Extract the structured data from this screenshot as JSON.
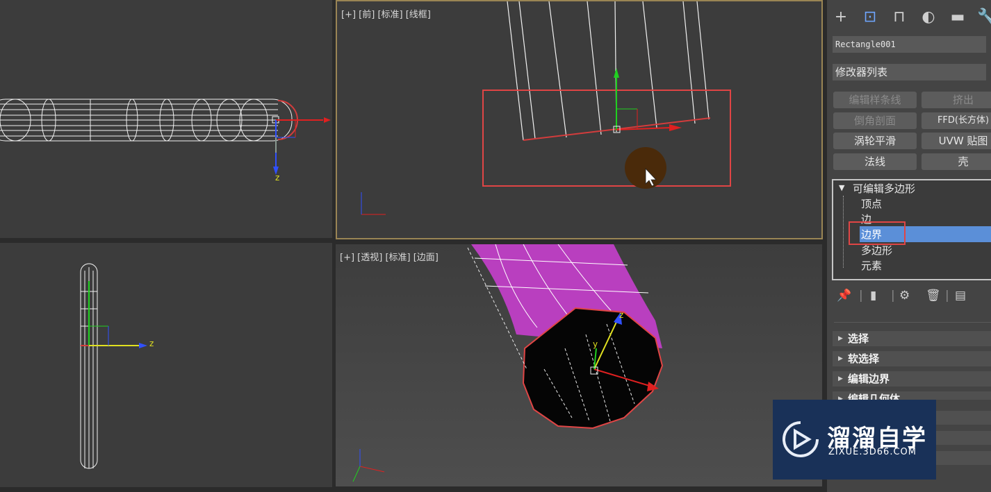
{
  "viewports": {
    "top_left": {
      "axis_label": "z"
    },
    "front": {
      "label": "[+] [前] [标准] [线框]"
    },
    "left": {
      "axis_label": "z"
    },
    "perspective": {
      "label": "[+] [透视] [标准] [边面]",
      "axis_z": "z",
      "axis_y": "y"
    }
  },
  "command_panel": {
    "tabs": [
      "create-icon",
      "modify-icon",
      "hierarchy-icon",
      "motion-icon",
      "display-icon",
      "utilities-icon"
    ],
    "object_name": "Rectangle001",
    "modifier_list": "修改器列表",
    "modifier_buttons": [
      {
        "label": "编辑样条线",
        "enabled": false
      },
      {
        "label": "挤出",
        "enabled": false
      },
      {
        "label": "倒角剖面",
        "enabled": false
      },
      {
        "label": "FFD(长方体)",
        "enabled": true
      },
      {
        "label": "涡轮平滑",
        "enabled": true
      },
      {
        "label": "UVW 贴图",
        "enabled": true
      },
      {
        "label": "法线",
        "enabled": true
      },
      {
        "label": "壳",
        "enabled": true
      }
    ],
    "stack": {
      "root": "可编辑多边形",
      "items": [
        "顶点",
        "边",
        "边界",
        "多边形",
        "元素"
      ],
      "selected": "边界"
    },
    "stack_tools": [
      "pin-icon",
      "show-result-icon",
      "make-unique-icon",
      "remove-modifier-icon",
      "configure-icon"
    ],
    "rollouts": [
      "选择",
      "软选择",
      "编辑边界",
      "编辑几何体"
    ]
  },
  "watermark": {
    "title": "溜溜自学",
    "url": "ZIXUE.3D66.COM"
  },
  "colors": {
    "highlight": "#e04545",
    "selection": "#5b8fd8",
    "accent_purple": "#b93fbf"
  }
}
